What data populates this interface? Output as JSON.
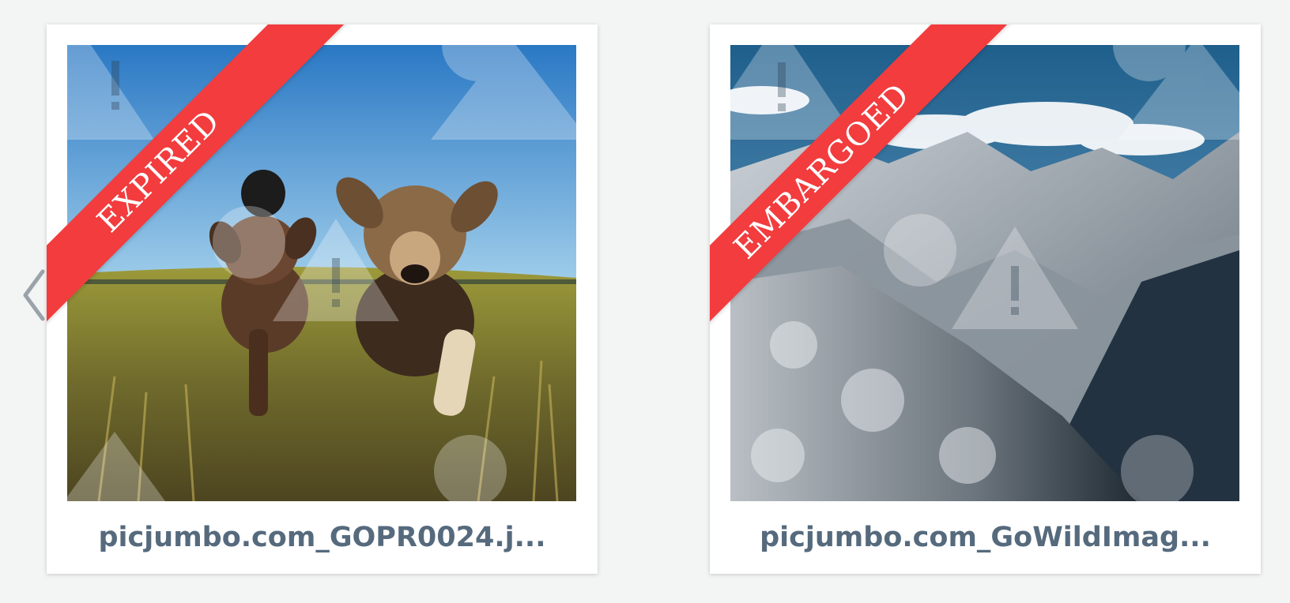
{
  "gallery": {
    "items": [
      {
        "status_label": "EXPIRED",
        "filename": "picjumbo.com_GOPR0024.j...",
        "ribbon_color": "#f23c3e"
      },
      {
        "status_label": "EMBARGOED",
        "filename": "picjumbo.com_GoWildImag...",
        "ribbon_color": "#f23c3e"
      }
    ],
    "nav": {
      "prev_icon": "chevron-left-icon"
    }
  },
  "colors": {
    "background": "#f3f4f4",
    "card": "#ffffff",
    "caption_text": "#566a7d",
    "ribbon": "#f23c3e"
  }
}
